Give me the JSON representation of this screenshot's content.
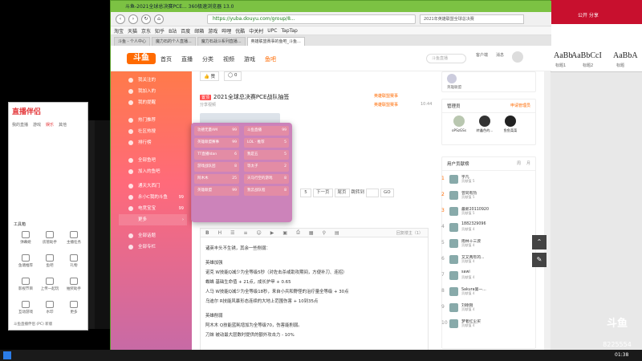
{
  "browser": {
    "window_title": "斗鱼-2021全球总决赛PCE... 360极速浏览器 13.0",
    "url": "https://yuba.douyu.com/group/8...",
    "search_hint": "2021年英雄联盟全球总决赛",
    "bookmarks": [
      "淘宝",
      "天猫",
      "京东",
      "知乎",
      "B站",
      "百度",
      "邮箱",
      "游戏",
      "哔哩",
      "优酷",
      "中关村",
      "UPC",
      "TapTap"
    ],
    "tabs": [
      "斗鱼 - 个人中心",
      "魔力石的个人直播...",
      "魔力石战斗系列直播...",
      "英雄联盟赛事的鱼吧_斗鱼..."
    ]
  },
  "header": {
    "logo": "斗鱼",
    "nav": [
      "首页",
      "直播",
      "分类",
      "视频",
      "游戏",
      "鱼吧"
    ],
    "search_placeholder": "斗鱼直播",
    "icons_labels": [
      "客户端",
      "消息"
    ]
  },
  "sidebar": {
    "items": [
      {
        "label": "我关注的",
        "count": ""
      },
      {
        "label": "我加入的",
        "count": ""
      },
      {
        "label": "我的提醒",
        "count": ""
      },
      {
        "label": "热门推荐",
        "count": ""
      },
      {
        "label": "社区热搜",
        "count": ""
      },
      {
        "label": "排行榜",
        "count": ""
      },
      {
        "label": "全部鱼吧",
        "count": ""
      },
      {
        "label": "加入的鱼吧",
        "count": ""
      },
      {
        "label": "通天大西门",
        "count": ""
      },
      {
        "label": "永小C我的斗鱼",
        "count": "99"
      },
      {
        "label": "电竞宝宝",
        "count": "99"
      },
      {
        "label": "更多",
        "count": ""
      },
      {
        "label": "全部话题",
        "count": ""
      },
      {
        "label": "全部专栏",
        "count": ""
      }
    ]
  },
  "post": {
    "top_like": "赞",
    "top_comment": "0",
    "badge": "置顶",
    "title": "2021全球总决赛PCE战队抽签",
    "subtitle": "分享视频",
    "source": "英雄联盟赛事",
    "time": "10:44"
  },
  "popup": {
    "items": [
      {
        "label": "功德无量AM",
        "count": "99"
      },
      {
        "label": "斗鱼直播",
        "count": "99"
      },
      {
        "label": "英雄联盟赛事",
        "count": "99"
      },
      {
        "label": "LOL · 推荐",
        "count": "5"
      },
      {
        "label": "TT直播ldan",
        "count": "6"
      },
      {
        "label": "我是五",
        "count": "5"
      },
      {
        "label": "游戏战队团",
        "count": "8"
      },
      {
        "label": "等太子",
        "count": "2"
      },
      {
        "label": "阿木木",
        "count": "25"
      },
      {
        "label": "天马行空的游戏",
        "count": "8"
      },
      {
        "label": "英雄联盟",
        "count": "99"
      },
      {
        "label": "我云战队程",
        "count": "8"
      }
    ]
  },
  "pager": {
    "page": "5",
    "next": "下一页",
    "last": "尾页",
    "jump": "跳转到",
    "go": "GO"
  },
  "editor": {
    "counter": "回复楼主（1）",
    "lines": [
      "诸英丰头不生锈，其余一些削弱：",
      "",
      "英雄加强",
      "诺克   W技能Q减少为全等级5秒（对佐击杀或助攻期间，方便补刀、连招）",
      "蜘蛛   基础生命值 + 21点，成长护甲 + 0.65",
      "人马   W技能Q减少为全等级18秒，来自小兵和野怪的治疗量全等级 + 30点",
      "乌迪尔  R技能风暴形态连续的大地上范围伤害 + 10到35点",
      "",
      "英雄削弱",
      "阿木木  Q技能蓝耗增加为全等级70，伤害能削弱。",
      "刀妹   被动最大层数时提供的额外攻击力 - 10%"
    ]
  },
  "rightcol": {
    "group_label": "英雄联盟",
    "admins_title": "管理员",
    "admins_more": "申请管理员",
    "admins": [
      "oPSzGSs",
      "转鑫色的...",
      "鱼鱼菜菜"
    ],
    "contrib_title": "用户贡献榜",
    "contrib_tabs": [
      "周",
      "月"
    ],
    "ranks": [
      {
        "no": "1",
        "name": "宇凡",
        "sub": "贡献值 5"
      },
      {
        "no": "2",
        "name": "曾同有热",
        "sub": "贡献值 5"
      },
      {
        "no": "3",
        "name": "最新20110920",
        "sub": "贡献值 5"
      },
      {
        "no": "4",
        "name": "1882329096",
        "sub": "贡献值 4"
      },
      {
        "no": "5",
        "name": "雨林十三渡",
        "sub": "贡献值 4"
      },
      {
        "no": "6",
        "name": "又又两年的...",
        "sub": "贡献值 4"
      },
      {
        "no": "7",
        "name": "sawi",
        "sub": "贡献值 4"
      },
      {
        "no": "8",
        "name": "Sakura第一...",
        "sub": "贡献值 4"
      },
      {
        "no": "9",
        "name": "刘德刚",
        "sub": "贡献值 4"
      },
      {
        "no": "10",
        "name": "梦者红尘买",
        "sub": "贡献值 4"
      }
    ]
  },
  "left_app": {
    "logo": "直播伴侣",
    "tabs": [
      "我的直播",
      "游戏",
      "娱乐",
      "其他"
    ],
    "tools_title": "工具箱",
    "tools": [
      "弹幕姬",
      "房管助手",
      "主播任务",
      "鱼塘推荐",
      "鱼吧",
      "礼物",
      "影视节目",
      "上传一起玩",
      "抽奖助手",
      "互动游戏",
      "水印",
      "更多"
    ],
    "footer": "斗鱼直播伴侣 (PC) 新版"
  },
  "right_bg": {
    "styles": [
      "AaBb",
      "AaBbCcI",
      "AaBbA"
    ],
    "style_labels": [
      "标题1",
      "标题2",
      "标题"
    ],
    "toolbar_text": "公开 分享"
  },
  "overlay": {
    "douyu_mark": "斗鱼",
    "room_id": "8225554"
  },
  "taskbar": {
    "clock": "01:38"
  }
}
